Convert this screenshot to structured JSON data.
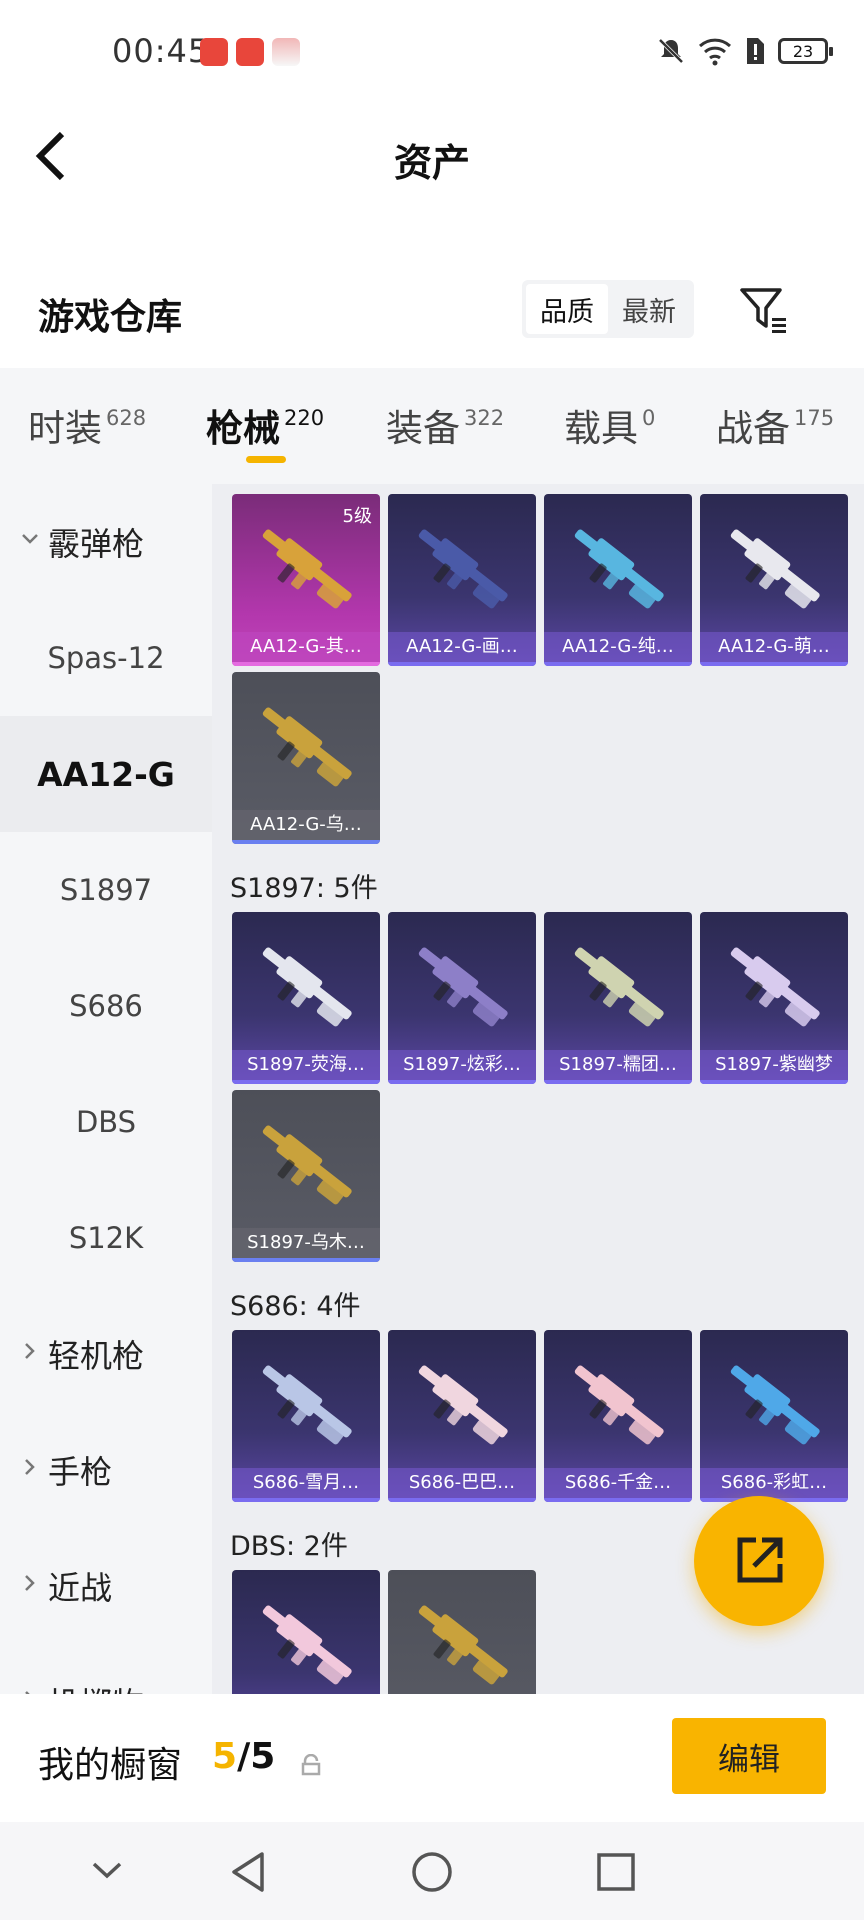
{
  "status_bar": {
    "time": "00:45",
    "battery": "23"
  },
  "header": {
    "title": "资产"
  },
  "warehouse": {
    "title": "游戏仓库",
    "sort_options": [
      "品质",
      "最新"
    ]
  },
  "tabs": [
    {
      "label": "时装",
      "count": "628",
      "active": false
    },
    {
      "label": "枪械",
      "count": "220",
      "active": true
    },
    {
      "label": "装备",
      "count": "322",
      "active": false
    },
    {
      "label": "载具",
      "count": "0",
      "active": false
    },
    {
      "label": "战备",
      "count": "175",
      "active": false
    }
  ],
  "sidebar": [
    {
      "label": "霰弹枪",
      "type": "category",
      "expanded": true
    },
    {
      "label": "Spas-12",
      "type": "sub"
    },
    {
      "label": "AA12-G",
      "type": "sub",
      "selected": true
    },
    {
      "label": "S1897",
      "type": "sub"
    },
    {
      "label": "S686",
      "type": "sub"
    },
    {
      "label": "DBS",
      "type": "sub"
    },
    {
      "label": "S12K",
      "type": "sub"
    },
    {
      "label": "轻机枪",
      "type": "category"
    },
    {
      "label": "手枪",
      "type": "category"
    },
    {
      "label": "近战",
      "type": "category"
    },
    {
      "label": "投掷物",
      "type": "category"
    }
  ],
  "sections": [
    {
      "title": "",
      "items": [
        {
          "name": "AA12-G-其…",
          "rarity": "pink",
          "level": "5级",
          "color": "#d8a23a"
        },
        {
          "name": "AA12-G-画…",
          "rarity": "purple",
          "color": "#4a5aa8"
        },
        {
          "name": "AA12-G-纯…",
          "rarity": "purple",
          "color": "#58b6e0"
        },
        {
          "name": "AA12-G-萌…",
          "rarity": "purple",
          "color": "#e8e8ee"
        },
        {
          "name": "AA12-G-乌…",
          "rarity": "gray",
          "color": "#c9a23c"
        }
      ]
    },
    {
      "title": "S1897: 5件",
      "items": [
        {
          "name": "S1897-荧海…",
          "rarity": "purple",
          "color": "#e4e6ee"
        },
        {
          "name": "S1897-炫彩…",
          "rarity": "purple",
          "color": "#8d7fc8"
        },
        {
          "name": "S1897-糯团…",
          "rarity": "purple",
          "color": "#cfd3b0"
        },
        {
          "name": "S1897-紫幽梦",
          "rarity": "purple",
          "color": "#d8cbee"
        },
        {
          "name": "S1897-乌木…",
          "rarity": "gray",
          "color": "#c9a23c"
        }
      ]
    },
    {
      "title": "S686: 4件",
      "items": [
        {
          "name": "S686-雪月…",
          "rarity": "purple",
          "color": "#b9c6e6"
        },
        {
          "name": "S686-巴巴…",
          "rarity": "purple",
          "color": "#f0d6df"
        },
        {
          "name": "S686-千金…",
          "rarity": "purple",
          "color": "#f1c4cf"
        },
        {
          "name": "S686-彩虹…",
          "rarity": "purple",
          "color": "#4fa8e8"
        }
      ]
    },
    {
      "title": "DBS: 2件",
      "items": [
        {
          "name": "",
          "rarity": "purple",
          "color": "#f2c8dc"
        },
        {
          "name": "",
          "rarity": "gray",
          "color": "#c9a23c"
        }
      ]
    }
  ],
  "showcase": {
    "label": "我的橱窗",
    "current": "5",
    "slash_total": "/5",
    "edit_label": "编辑"
  }
}
